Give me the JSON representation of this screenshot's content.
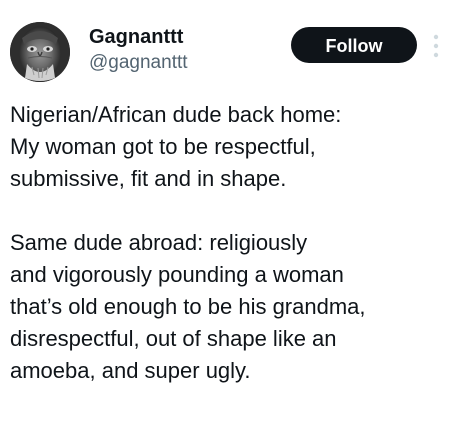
{
  "tweet": {
    "author": {
      "display_name": "Gagnanttt",
      "handle": "@gagnanttt",
      "avatar_icon": "profile-photo"
    },
    "follow_label": "Follow",
    "more_icon": "more-options-icon",
    "text": "Nigerian/African dude back home:\nMy woman got to be respectful,\nsubmissive, fit and in shape.\n\nSame dude abroad: religiously\nand vigorously pounding a woman\nthat’s old enough to be his grandma,\ndisrespectful, out of shape like an\namoeba, and super ugly."
  },
  "colors": {
    "text_primary": "#0f1419",
    "text_secondary": "#536471",
    "follow_bg": "#0f1419",
    "follow_text": "#ffffff",
    "more_icon": "#cfd9de"
  }
}
